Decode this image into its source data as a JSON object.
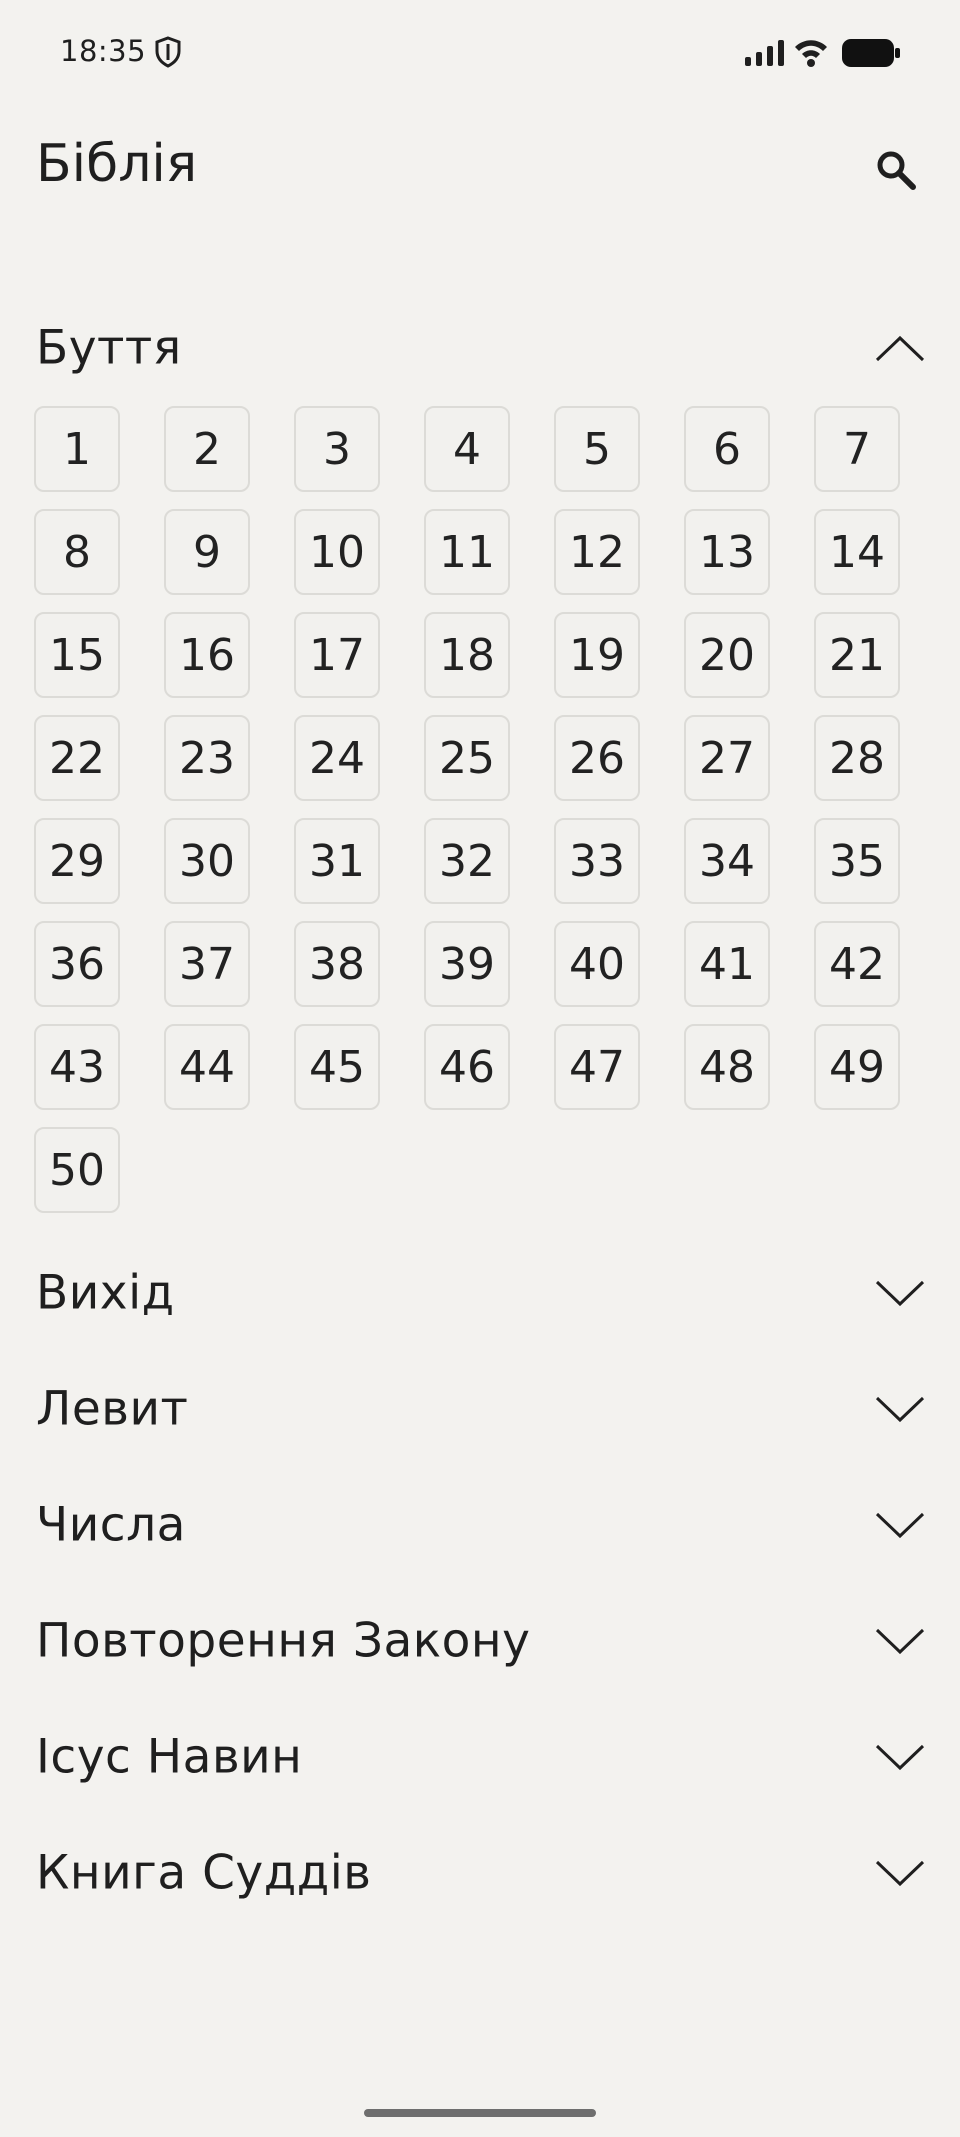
{
  "status_bar": {
    "time": "18:35"
  },
  "header": {
    "title": "Біблія"
  },
  "books": [
    {
      "name": "Буття",
      "expanded": true,
      "chapters": [
        "1",
        "2",
        "3",
        "4",
        "5",
        "6",
        "7",
        "8",
        "9",
        "10",
        "11",
        "12",
        "13",
        "14",
        "15",
        "16",
        "17",
        "18",
        "19",
        "20",
        "21",
        "22",
        "23",
        "24",
        "25",
        "26",
        "27",
        "28",
        "29",
        "30",
        "31",
        "32",
        "33",
        "34",
        "35",
        "36",
        "37",
        "38",
        "39",
        "40",
        "41",
        "42",
        "43",
        "44",
        "45",
        "46",
        "47",
        "48",
        "49",
        "50"
      ]
    },
    {
      "name": "Вихід",
      "expanded": false
    },
    {
      "name": "Левит",
      "expanded": false
    },
    {
      "name": "Числа",
      "expanded": false
    },
    {
      "name": "Повторення Закону",
      "expanded": false
    },
    {
      "name": "Ісус Навин",
      "expanded": false
    },
    {
      "name": "Книга Суддів",
      "expanded": false
    }
  ],
  "icons": {
    "search": "search-icon",
    "expand": "chevron-down-icon",
    "collapse": "chevron-up-icon"
  }
}
